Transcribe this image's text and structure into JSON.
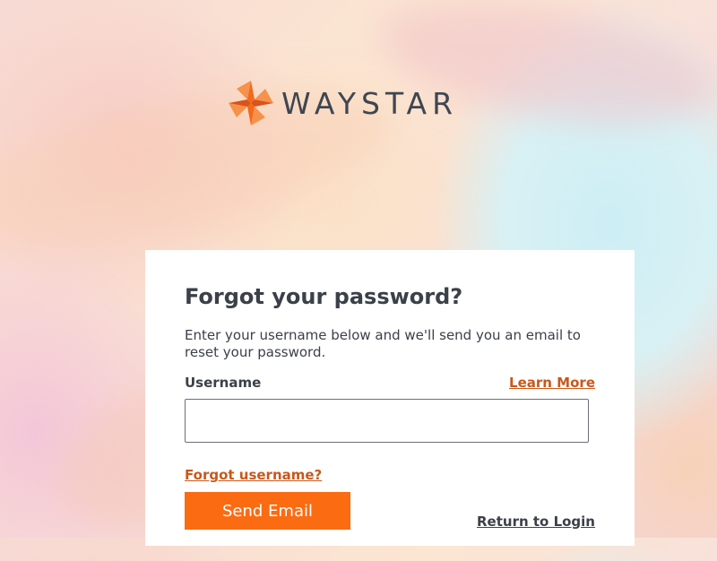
{
  "brand": {
    "name": "WAYSTAR",
    "colors": {
      "accent": "#fb6b12",
      "link": "#c9581a",
      "text": "#3b4049",
      "logo_text": "#3f4650"
    },
    "logo_icon": "waystar-star-icon"
  },
  "form": {
    "title": "Forgot your password?",
    "description": "Enter your username below and we'll send you an email to reset your password.",
    "username_label": "Username",
    "learn_more": "Learn More",
    "username_value": "",
    "forgot_username": "Forgot username?",
    "send_button": "Send Email",
    "return_link": "Return to Login"
  }
}
